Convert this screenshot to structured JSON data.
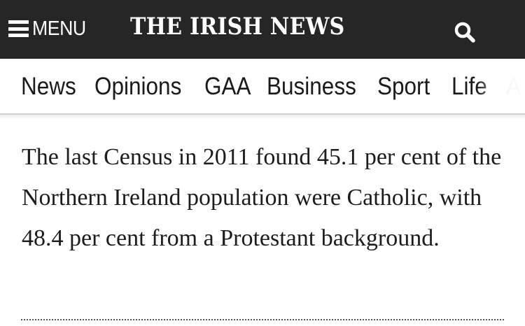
{
  "header": {
    "menu_label": "MENU",
    "logo_text": "THE IRISH NEWS",
    "search_icon": "search-icon",
    "background": "#262626"
  },
  "nav": {
    "items": [
      {
        "label": "News"
      },
      {
        "label": "Opinions"
      },
      {
        "label": "GAA"
      },
      {
        "label": "Business"
      },
      {
        "label": "Sport"
      },
      {
        "label": "Life"
      },
      {
        "label": "A"
      }
    ]
  },
  "article": {
    "paragraph": "The last Census in 2011 found 45.1 per cent of the Northern Ireland population were Catholic, with 48.4 per cent from a Protestant background."
  }
}
